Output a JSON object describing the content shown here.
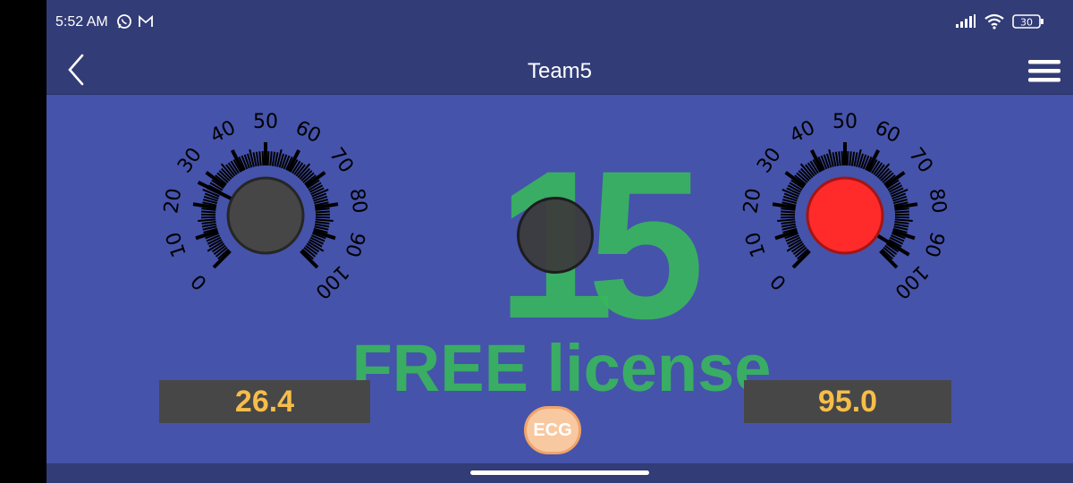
{
  "status_bar": {
    "time": "5:52 AM",
    "battery": "30",
    "icons_left": [
      "whatsapp-icon",
      "gmail-icon"
    ],
    "icons_right": [
      "signal-icon",
      "wifi-icon",
      "battery-icon"
    ]
  },
  "app_bar": {
    "title": "Team5",
    "back_icon": "chevron-left-icon",
    "menu_icon": "hamburger-menu-icon"
  },
  "gauge_left": {
    "labels": [
      "0",
      "10",
      "20",
      "30",
      "40",
      "50",
      "60",
      "70",
      "80",
      "90",
      "100"
    ],
    "needle_value": 26.4,
    "knob_color": "#464646"
  },
  "gauge_right": {
    "labels": [
      "0",
      "10",
      "20",
      "30",
      "40",
      "50",
      "60",
      "70",
      "80",
      "90",
      "100"
    ],
    "needle_value": 95.0,
    "knob_color": "#ff2a2a"
  },
  "readout_left": "26.4",
  "readout_right": "95.0",
  "watermark": {
    "number": "15",
    "text": "FREE license"
  },
  "ecg_button_label": "ECG",
  "colors": {
    "background": "#4553ab",
    "bar": "#323c77",
    "readout_text": "#f6bd49",
    "watermark": "#38b55c"
  }
}
